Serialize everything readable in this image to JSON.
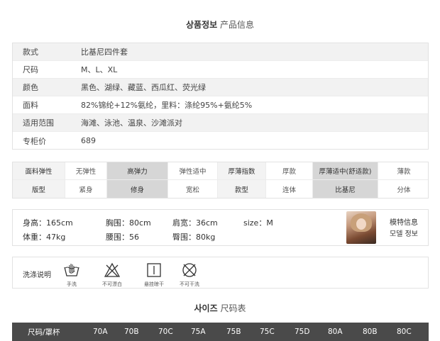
{
  "header": {
    "title_ko": "상품정보",
    "title_zh": "产品信息"
  },
  "info": [
    {
      "key": "款式",
      "value": "比基尼四件套"
    },
    {
      "key": "尺码",
      "value": "M、L、XL"
    },
    {
      "key": "颜色",
      "value": "黑色、湖绿、藏蓝、西瓜红、荧光绿"
    },
    {
      "key": "面料",
      "value": "82%锦纶+12%氨纶，里料：涤纶95%+氨纶5%"
    },
    {
      "key": "适用范围",
      "value": "海滩、泳池、温泉、沙滩派对"
    },
    {
      "key": "专柜价",
      "value": "689"
    }
  ],
  "attributes": {
    "row1": [
      "面料弹性",
      "无弹性",
      "高弹力",
      "弹性适中",
      "厚薄指数",
      "厚款",
      "厚薄适中(舒适款)",
      "薄款"
    ],
    "row2": [
      "版型",
      "紧身",
      "修身",
      "宽松",
      "款型",
      "连体",
      "比基尼",
      "分体"
    ]
  },
  "model": {
    "height": "身高：165cm",
    "weight": "体重：47kg",
    "bust": "胸围：80cm",
    "waist": "腰围：56",
    "shoulder": "肩宽：36cm",
    "hip": "臀围：80kg",
    "size": "size：M",
    "label_zh": "模特信息",
    "label_ko": "모델 정보"
  },
  "care": {
    "label": "洗涤说明",
    "items": [
      "手洗",
      "不可漂白",
      "悬挂晾干",
      "不可干洗"
    ]
  },
  "size_section": {
    "title_ko": "사이즈",
    "title_zh": "尺码表"
  },
  "size_table": {
    "header_label": "尺码/罩杯",
    "sizes": [
      "70A",
      "70B",
      "70C",
      "75A",
      "75B",
      "75C",
      "75D",
      "80A",
      "80B",
      "80C"
    ]
  }
}
